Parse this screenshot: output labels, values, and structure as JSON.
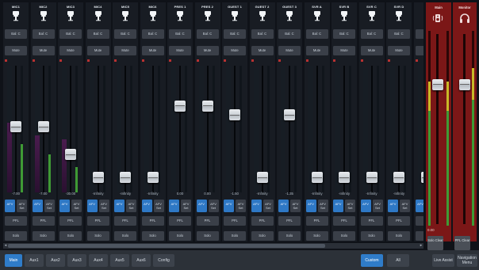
{
  "channels": [
    {
      "name": "MIC1",
      "bal": "Bal: C",
      "mute": "Mute",
      "level": "-7.00",
      "fader": 0.52,
      "meter": 0.55,
      "meter2": 0.38,
      "afv": "AFV",
      "afv_set": "AFV Set",
      "pfl": "PFL",
      "solo": "Solo"
    },
    {
      "name": "MIC2",
      "bal": "Bal: C",
      "mute": "Mute",
      "level": "-7.00",
      "fader": 0.52,
      "meter": 0.45,
      "meter2": 0.3,
      "afv": "AFV",
      "afv_set": "AFV Set",
      "pfl": "PFL",
      "solo": "Solo"
    },
    {
      "name": "MIC3",
      "bal": "Bal: C",
      "mute": "Mute",
      "level": "-30.00",
      "fader": 0.28,
      "meter": 0.42,
      "meter2": 0.2,
      "afv": "AFV",
      "afv_set": "AFV Set",
      "pfl": "PFL",
      "solo": "Solo"
    },
    {
      "name": "MIC4",
      "bal": "Bal: C",
      "mute": "Mute",
      "level": "-Infinity",
      "fader": 0.08,
      "meter": 0.0,
      "meter2": 0.0,
      "afv": "AFV",
      "afv_set": "AFV Set",
      "pfl": "PFL",
      "solo": "Solo"
    },
    {
      "name": "MIC5",
      "bal": "Bal: C",
      "mute": "Mute",
      "level": "-Infinity",
      "fader": 0.08,
      "meter": 0.0,
      "meter2": 0.0,
      "afv": "AFV",
      "afv_set": "AFV Set",
      "pfl": "PFL",
      "solo": "Solo"
    },
    {
      "name": "MIC6",
      "bal": "Bal: C",
      "mute": "Mute",
      "level": "-Infinity",
      "fader": 0.08,
      "meter": 0.0,
      "meter2": 0.0,
      "afv": "AFV",
      "afv_set": "AFV Set",
      "pfl": "PFL",
      "solo": "Solo"
    },
    {
      "name": "PRES 1",
      "bal": "Bal: C",
      "mute": "Mute",
      "level": "0.00",
      "fader": 0.7,
      "meter": 0.0,
      "meter2": 0.0,
      "afv": "AFV",
      "afv_set": "AFV Set",
      "pfl": "PFL",
      "solo": "Solo"
    },
    {
      "name": "PRES 2",
      "bal": "Bal: C",
      "mute": "Mute",
      "level": "0.00",
      "fader": 0.7,
      "meter": 0.0,
      "meter2": 0.0,
      "afv": "AFV",
      "afv_set": "AFV Set",
      "pfl": "PFL",
      "solo": "Solo"
    },
    {
      "name": "GUEST 1",
      "bal": "Bal: C",
      "mute": "Mute",
      "level": "-1.50",
      "fader": 0.62,
      "meter": 0.0,
      "meter2": 0.0,
      "afv": "AFV",
      "afv_set": "AFV Set",
      "pfl": "PFL",
      "solo": "Solo"
    },
    {
      "name": "GUEST 2",
      "bal": "Bal: C",
      "mute": "Mute",
      "level": "-Infinity",
      "fader": 0.08,
      "meter": 0.0,
      "meter2": 0.0,
      "afv": "AFV",
      "afv_set": "AFV Set",
      "pfl": "PFL",
      "solo": "Solo"
    },
    {
      "name": "GUEST 3",
      "bal": "Bal: C",
      "mute": "Mute",
      "level": "-1.35",
      "fader": 0.62,
      "meter": 0.0,
      "meter2": 0.0,
      "afv": "AFV",
      "afv_set": "AFV Set",
      "pfl": "PFL",
      "solo": "Solo"
    },
    {
      "name": "SVR A",
      "bal": "Bal: C",
      "mute": "Mute",
      "level": "-Infinity",
      "fader": 0.08,
      "meter": 0.0,
      "meter2": 0.0,
      "afv": "AFV",
      "afv_set": "AFV Set",
      "pfl": "PFL",
      "solo": "Solo"
    },
    {
      "name": "SVR B",
      "bal": "Bal: C",
      "mute": "Mute",
      "level": "-Infinity",
      "fader": 0.08,
      "meter": 0.0,
      "meter2": 0.0,
      "afv": "AFV",
      "afv_set": "AFV Set",
      "pfl": "PFL",
      "solo": "Solo"
    },
    {
      "name": "SVR C",
      "bal": "Bal: C",
      "mute": "Mute",
      "level": "-Infinity",
      "fader": 0.08,
      "meter": 0.0,
      "meter2": 0.0,
      "afv": "AFV",
      "afv_set": "AFV Set",
      "pfl": "PFL",
      "solo": "Solo"
    },
    {
      "name": "SVR D",
      "bal": "Bal: C",
      "mute": "Mute",
      "level": "-Infinity",
      "fader": 0.08,
      "meter": 0.0,
      "meter2": 0.0,
      "afv": "AFV",
      "afv_set": "AFV Set",
      "pfl": "PFL",
      "solo": "Solo"
    },
    {
      "name": "Au",
      "bal": "Ba",
      "mute": "M",
      "level": "",
      "fader": 0.08,
      "meter": 0.0,
      "meter2": 0.0,
      "afv": "AFV",
      "afv_set": "",
      "pfl": "",
      "solo": ""
    }
  ],
  "master": {
    "title": "Main",
    "level": "0.00",
    "fader": 0.75,
    "btn": "Solo Clear",
    "meter": 0.82
  },
  "monitor": {
    "title": "Monitor",
    "fader": 0.75,
    "btn": "PFL Clear",
    "meter": 0.9
  },
  "tabs": [
    "Main",
    "Aux1",
    "Aux2",
    "Aux3",
    "Aux4",
    "Aux5",
    "Aux6",
    "Config"
  ],
  "active_tab": "Main",
  "view_buttons": [
    "Custom",
    "All"
  ],
  "active_view": "Custom",
  "right_buttons": [
    "Live Assist",
    "Navigation Menu"
  ],
  "colors": {
    "accent": "#2f7cc9",
    "master_bg": "#7b1717",
    "meter_green": "#3f9a35",
    "meter_yellow": "#c8b928"
  },
  "icons": {
    "channel": "microphone-icon",
    "master": "speaker-icon",
    "monitor": "headphones-icon"
  }
}
